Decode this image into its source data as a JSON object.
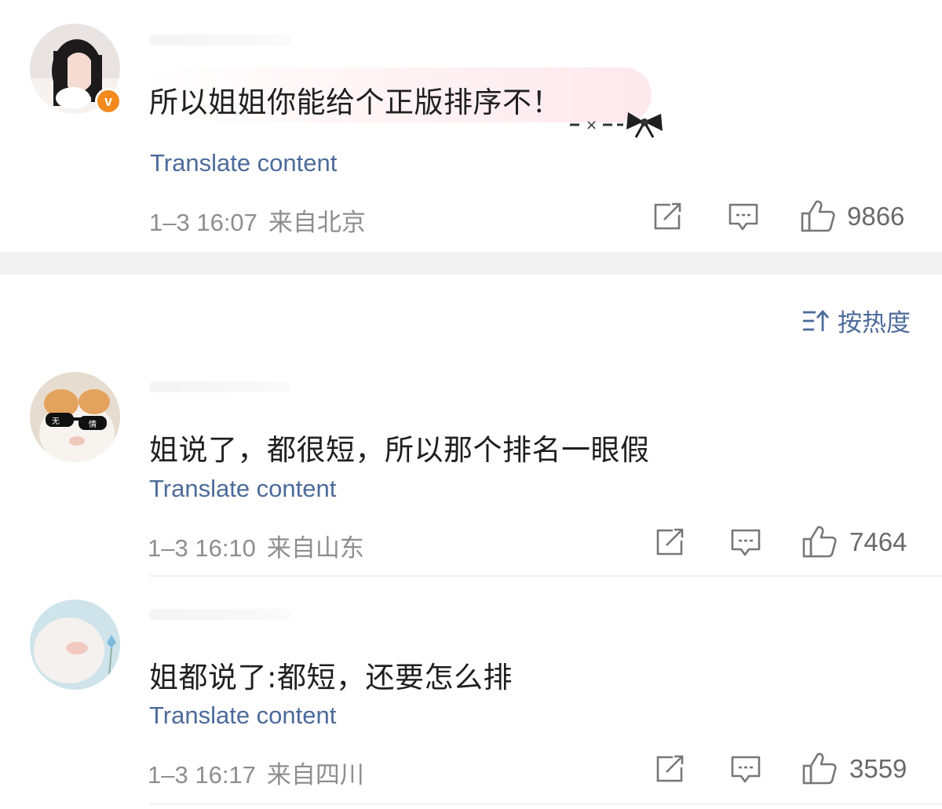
{
  "comments": [
    {
      "text": "所以姐姐你能给个正版排序不！",
      "translate": "Translate content",
      "date": "1–3 16:07",
      "location": "来自北京",
      "likes": "9866",
      "verified_badge": "v"
    },
    {
      "text": "姐说了，都很短，所以那个排名一眼假",
      "translate": "Translate content",
      "date": "1–3 16:10",
      "location": "来自山东",
      "likes": "7464"
    },
    {
      "text": "姐都说了:都短，还要怎么排",
      "translate": "Translate content",
      "date": "1–3 16:17",
      "location": "来自四川",
      "likes": "3559"
    }
  ],
  "sort": {
    "label": "按热度",
    "icon": "sort-icon"
  },
  "icons": {
    "share": "share-icon",
    "reply": "comment-icon",
    "like": "thumbs-up-icon"
  },
  "colors": {
    "link": "#4d6b9a",
    "meta": "#8e8e8e",
    "badge": "#f28a1e",
    "separator": "#f2f2f2"
  }
}
